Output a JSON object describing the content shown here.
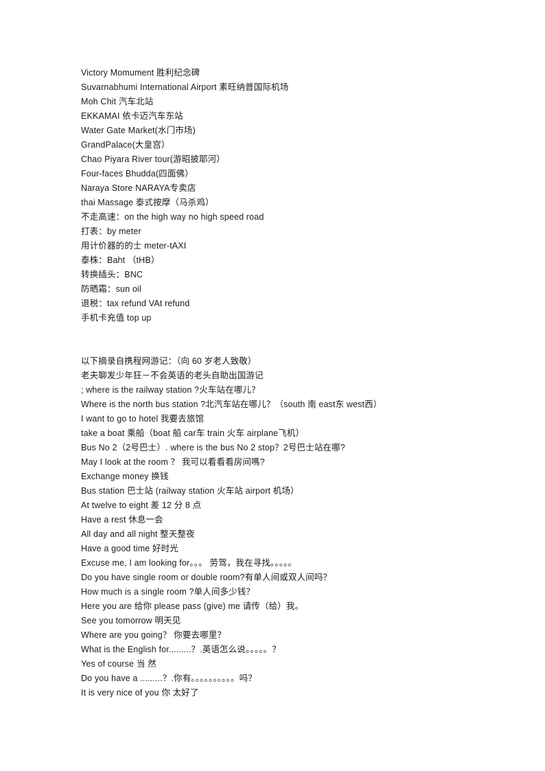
{
  "document": {
    "blocks": [
      {
        "name": "places-and-terms-block",
        "lines": [
          "Victory Momument 胜利纪念碑",
          "Suvarnabhumi International Airport 素旺纳普国际机场",
          "Moh Chit 汽车北站",
          "EKKAMAI 依卡迈汽车东站",
          "Water Gate Market(水门市场)",
          "GrandPalace(大皇宫）",
          "Chao Piyara River tour(游昭披耶河）",
          "Four-faces Bhudda(四面佛）",
          "Naraya Store NARAYA专卖店",
          "thai Massage 泰式按摩（马杀鸡）",
          "不走高速：on the high way no high speed road",
          "打表：by meter",
          "用计价器的的士 meter-tAXI",
          "泰株：Baht （tHB）",
          "转换插头：BNC",
          "防晒霜：sun oil",
          "退税：tax refund VAt refund",
          "手机卡充值 top up"
        ]
      },
      {
        "name": "travelogue-phrases-block",
        "lines": [
          "以下摘录自携程网游记：（向 60 岁老人致敬）",
          "老夫聊发少年狂－不会英语的老头自助出国游记",
          "; where is the railway station ?火车站在哪儿？",
          "Where is the north bus station ?北汽车站在哪儿？（south 南 east东 west西）",
          "I want to go to hotel 我要去旅馆",
          "take a boat 乘船（boat 船 car车 train 火车 airplane飞机）",
          "Bus No 2（2号巴士）. where is the bus No 2 stop？2号巴士站在哪?",
          "May I look at the room ？ 我可以看看看房间嗎?",
          "Exchange money 换钱",
          "Bus station 巴士站 (railway station 火车站 airport 机场）",
          "At twelve to eight 差 12 分 8 点",
          "Have a rest 休息一会",
          "All day and all night 整天整夜",
          "Have a good time 好时光",
          "Excuse me, I am looking for。。。 劳驾，我在寻找。。。。。",
          "Do you have single room or double room?有单人间或双人间吗？",
          "How much is a single room ?单人间多少钱？",
          "Here you are 给你 please pass (give) me 请传（给）我。",
          "See you tomorrow 明天见",
          "Where are you going？ 你要去哪里？",
          "What is the English for.........？.英语怎么说。。。。。？",
          "Yes of course 当 然",
          "Do you have a .........？.你有。。。。。。。。。。吗？",
          "It is very nice of you 你 太好了"
        ]
      }
    ]
  }
}
